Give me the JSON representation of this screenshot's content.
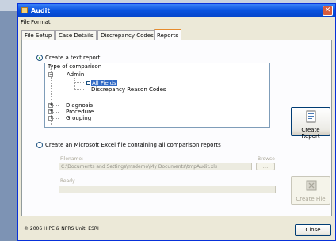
{
  "window": {
    "title": "Audit",
    "close_glyph": "✕"
  },
  "menu": {
    "items": [
      "File",
      "Format"
    ]
  },
  "tabs": [
    {
      "label": "File Setup"
    },
    {
      "label": "Case Details"
    },
    {
      "label": "Discrepancy Codes"
    },
    {
      "label": "Reports",
      "active": true
    }
  ],
  "reports": {
    "option_text": "Create a text report",
    "tree_header": "Type of comparison",
    "tree": {
      "admin": "Admin",
      "all_fields": "All Fields",
      "discrepancy_reason_codes": "Discrepancy Reason Codes",
      "diagnosis": "Diagnosis",
      "procedure": "Procedure",
      "grouping": "Grouping"
    },
    "create_report_label": "Create Report",
    "option_excel": "Create an Microsoft Excel file containing all comparison reports",
    "filename_label": "Filename:",
    "filename_value": "C:\\Documents and Settings\\msdemo\\My Documents\\tmpAudit.xls",
    "browse_label": "Browse",
    "browse_dots": "...",
    "ready_label": "Ready",
    "create_file_label": "Create File"
  },
  "footer": {
    "copyright": "© 2006 HIPE & NPRS Unit, ESRI",
    "close_label": "Close"
  },
  "icons": [
    "app-icon",
    "report-doc-icon",
    "excel-file-icon"
  ],
  "colors": {
    "title_bar": "#0a54e0",
    "selection": "#316ac5",
    "tab_highlight": "#e68b2c"
  }
}
